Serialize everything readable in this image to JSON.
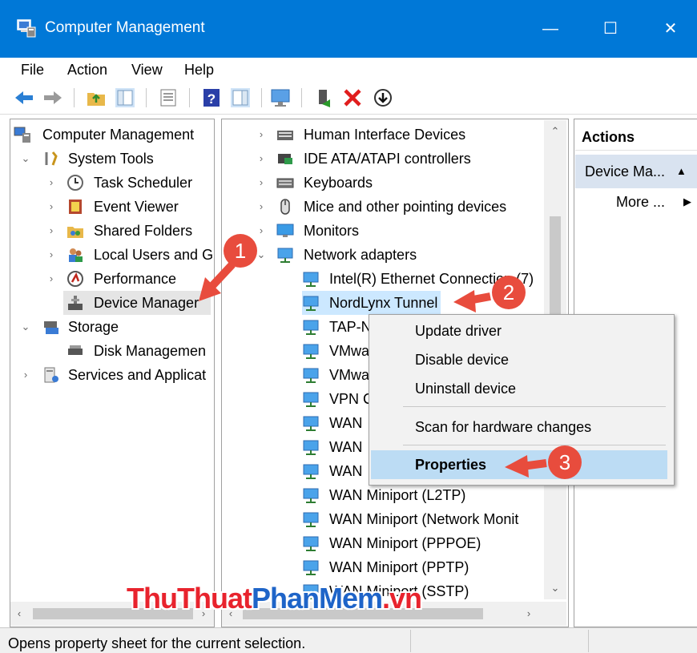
{
  "window": {
    "title": "Computer Management",
    "controls": [
      "—",
      "☐",
      "✕"
    ]
  },
  "menu": [
    "File",
    "Action",
    "View",
    "Help"
  ],
  "toolbar": [
    "back-icon",
    "forward-icon",
    "up-folder-icon",
    "show-hide-tree-icon",
    "properties-icon",
    "help-icon",
    "action-pane-icon",
    "monitor-icon",
    "enable-device-icon",
    "uninstall-icon",
    "update-driver-icon"
  ],
  "tree": {
    "root": "Computer Management",
    "system_tools": "System Tools",
    "task_scheduler": "Task Scheduler",
    "event_viewer": "Event Viewer",
    "shared_folders": "Shared Folders",
    "local_users": "Local Users and G",
    "performance": "Performance",
    "device_manager": "Device Manager",
    "storage": "Storage",
    "disk_management": "Disk Managemen",
    "services": "Services and Applicat"
  },
  "devices": {
    "categories": [
      "Human Interface Devices",
      "IDE ATA/ATAPI controllers",
      "Keyboards",
      "Mice and other pointing devices",
      "Monitors",
      "Network adapters"
    ],
    "adapters": [
      "Intel(R) Ethernet Connection (7)",
      "NordLynx Tunnel",
      "TAP-N",
      "VMwa",
      "VMwa",
      "VPN C",
      "WAN",
      "WAN",
      "WAN",
      "WAN Miniport (L2TP)",
      "WAN Miniport (Network Monit",
      "WAN Miniport (PPPOE)",
      "WAN Miniport (PPTP)",
      "WAN Miniport (SSTP)"
    ]
  },
  "context_menu": {
    "update": "Update driver",
    "disable": "Disable device",
    "uninstall": "Uninstall device",
    "scan": "Scan for hardware changes",
    "properties": "Properties"
  },
  "actions": {
    "title": "Actions",
    "group": "Device Ma...",
    "more": "More ..."
  },
  "status": "Opens property sheet for the current selection.",
  "annotations": [
    "1",
    "2",
    "3"
  ],
  "watermark": {
    "part1": "ThuThuat",
    "part2": "PhanMem",
    "part3": ".vn"
  },
  "colors": {
    "titlebar": "#0078d7",
    "annotation": "#e84c3d",
    "selection": "#cce8ff",
    "menu_highlight": "#bcdcf4"
  }
}
